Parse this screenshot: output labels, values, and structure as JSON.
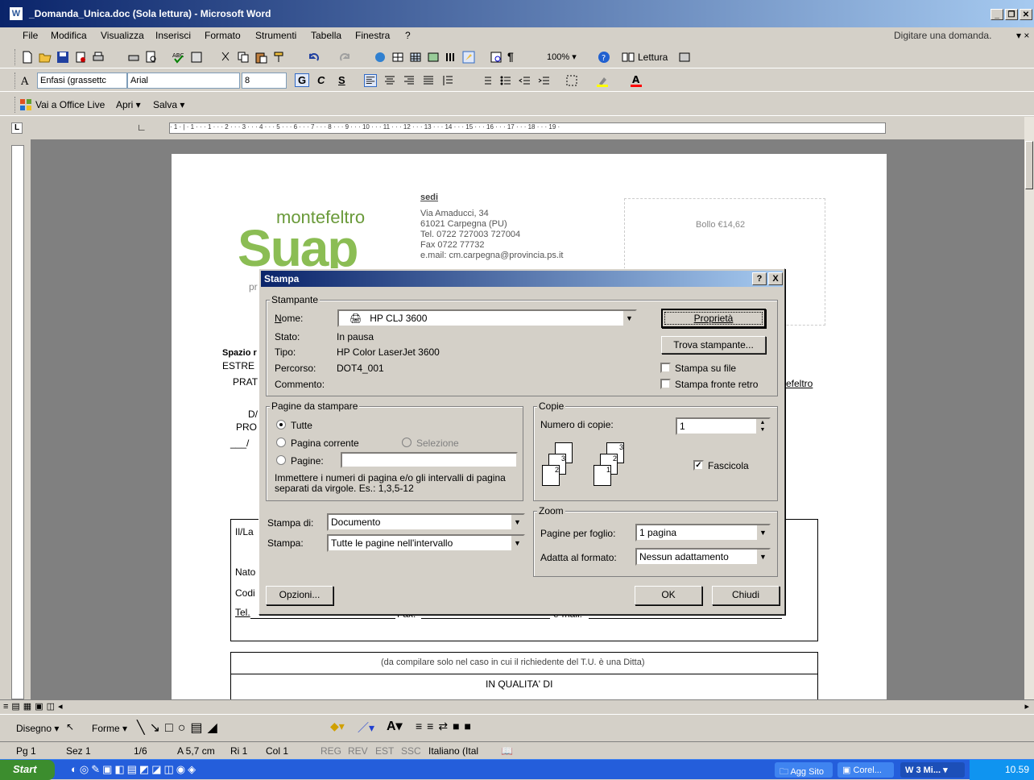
{
  "window": {
    "title": "_Domanda_Unica.doc (Sola lettura) - Microsoft Word",
    "app_icon": "word-icon"
  },
  "menu": {
    "items": [
      "File",
      "Modifica",
      "Visualizza",
      "Inserisci",
      "Formato",
      "Strumenti",
      "Tabella",
      "Finestra",
      "?"
    ],
    "help_placeholder": "Digitare una domanda."
  },
  "toolbar_standard": {
    "zoom": "100%",
    "reading_label": "Lettura"
  },
  "toolbar_format": {
    "style": "Enfasi (grassettc",
    "font": "Arial",
    "size": "8",
    "bold": "G",
    "italic": "C",
    "underline": "S"
  },
  "toolbar_office_live": {
    "office_live": "Vai a Office Live",
    "open": "Apri",
    "save": "Salva"
  },
  "document": {
    "logo_top": "montefeltro",
    "logo_main": "Suap",
    "sedi_label": "sedi",
    "address_lines": [
      "Via Amaducci, 34",
      "61021 Carpegna (PU)",
      "Tel. 0722 727003 727004",
      "Fax 0722 77732",
      "e.mail: cm.carpegna@provincia.ps.it"
    ],
    "stamp_label": "Bollo €14,62",
    "left_fragments": [
      "pr",
      "Spazio r",
      "ESTRE",
      "PRAT",
      "D/",
      "PRO",
      "___/"
    ],
    "right_fragment": "efeltro",
    "form_fragments": [
      "Il/La",
      "Nato",
      "Codi",
      "Tel."
    ],
    "form_line_labels": [
      "Fax:",
      "e-mail:"
    ],
    "ditta_note": "(da compilare solo nel caso in cui il richiedente del T.U. è una Ditta)",
    "qualita": "IN QUALITA' DI"
  },
  "dialog": {
    "title": "Stampa",
    "help_btn": "?",
    "close_btn": "X",
    "printer_group": "Stampante",
    "name_label": "Nome:",
    "printer_name": "HP CLJ 3600",
    "status_label": "Stato:",
    "status_value": "In pausa",
    "type_label": "Tipo:",
    "type_value": "HP Color LaserJet 3600",
    "path_label": "Percorso:",
    "path_value": "DOT4_001",
    "comment_label": "Commento:",
    "properties_btn": "Proprietà",
    "find_printer_btn": "Trova stampante...",
    "print_to_file": "Stampa su file",
    "duplex": "Stampa fronte retro",
    "pages_group": "Pagine da stampare",
    "all": "Tutte",
    "current_page": "Pagina corrente",
    "selection": "Selezione",
    "pages": "Pagine:",
    "pages_value": "",
    "pages_hint": "Immettere i numeri di pagina e/o gli intervalli di pagina separati da virgole. Es.: 1,3,5-12",
    "copies_group": "Copie",
    "num_copies_label": "Numero di copie:",
    "num_copies_value": "1",
    "collate": "Fascicola",
    "collate_checked": true,
    "print_what_label": "Stampa di:",
    "print_what_value": "Documento",
    "print_label": "Stampa:",
    "print_value": "Tutte le pagine nell'intervallo",
    "zoom_group": "Zoom",
    "pages_per_sheet_label": "Pagine per foglio:",
    "pages_per_sheet_value": "1 pagina",
    "scale_label": "Adatta al formato:",
    "scale_value": "Nessun adattamento",
    "options_btn": "Opzioni...",
    "ok_btn": "OK",
    "close_btn_label": "Chiudi"
  },
  "drawing_toolbar": {
    "draw": "Disegno",
    "shapes": "Forme"
  },
  "status": {
    "page": "Pg 1",
    "section": "Sez 1",
    "pages": "1/6",
    "at": "A 5,7 cm",
    "line": "Ri 1",
    "col": "Col 1",
    "modes": [
      "REG",
      "REV",
      "EST",
      "SSC"
    ],
    "language": "Italiano (Ital"
  },
  "taskbar": {
    "start": "Start",
    "tasks": [
      "Agg Sito",
      "Corel...",
      "3 Mi..."
    ],
    "clock": "10.59"
  }
}
